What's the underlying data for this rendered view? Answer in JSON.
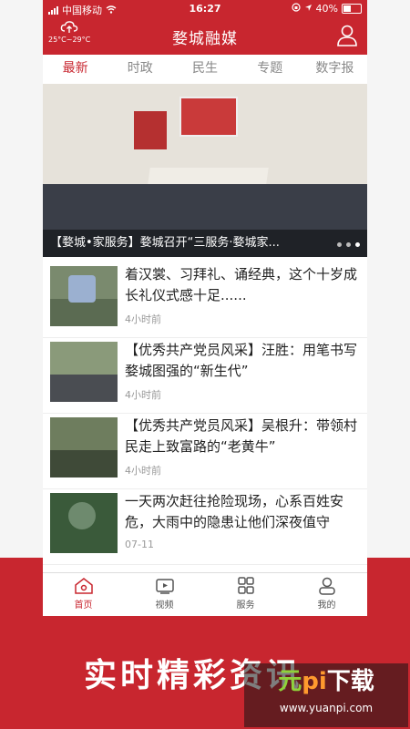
{
  "status": {
    "carrier": "中国移动",
    "time": "16:27",
    "battery": "40%"
  },
  "header": {
    "title": "婺城融媒",
    "weather": "25°C~29°C"
  },
  "tabs": [
    {
      "label": "最新"
    },
    {
      "label": "时政"
    },
    {
      "label": "民生"
    },
    {
      "label": "专题"
    },
    {
      "label": "数字报"
    }
  ],
  "banner": {
    "caption": "【婺城•家服务】婺城召开“三服务·婺城家..."
  },
  "news": [
    {
      "title": "着汉裳、习拜礼、诵经典，这个十岁成长礼仪式感十足......",
      "time": "4小时前"
    },
    {
      "title": "【优秀共产党员风采】汪胜：用笔书写婺城图强的“新生代”",
      "time": "4小时前"
    },
    {
      "title": "【优秀共产党员风采】吴根升：带领村民走上致富路的“老黄牛”",
      "time": "4小时前"
    },
    {
      "title": "一天两次赶往抢险现场，心系百姓安危，大雨中的隐患让他们深夜值守",
      "time": "07-11"
    }
  ],
  "bottom_nav": [
    {
      "label": "首页",
      "icon": "home-icon"
    },
    {
      "label": "视频",
      "icon": "video-icon"
    },
    {
      "label": "服务",
      "icon": "grid-icon"
    },
    {
      "label": "我的",
      "icon": "profile-icon"
    }
  ],
  "promo": {
    "text": "实时精彩资讯"
  },
  "watermark": {
    "brand_green": "元",
    "brand_orange": "pi",
    "brand_text": "下载",
    "url": "www.yuanpi.com"
  },
  "colors": {
    "accent": "#c8262f"
  }
}
